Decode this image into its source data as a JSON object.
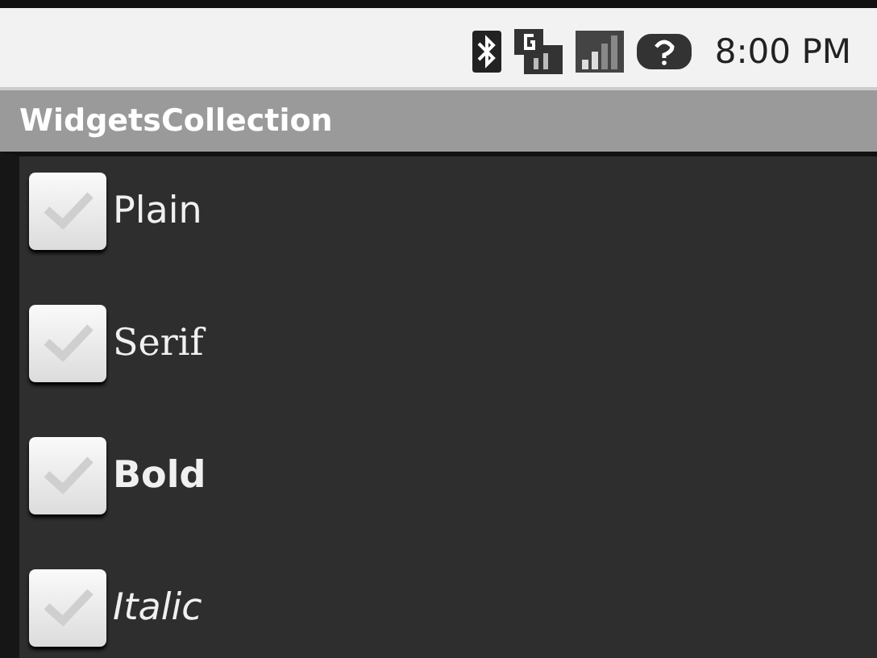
{
  "status_bar": {
    "time": "8:00 PM"
  },
  "title_bar": {
    "title": "WidgetsCollection"
  },
  "checkboxes": [
    {
      "label": "Plain",
      "kind": "plain",
      "checked": false
    },
    {
      "label": "Serif",
      "kind": "serif",
      "checked": false
    },
    {
      "label": "Bold",
      "kind": "bold",
      "checked": false
    },
    {
      "label": "Italic",
      "kind": "italic",
      "checked": false
    }
  ]
}
